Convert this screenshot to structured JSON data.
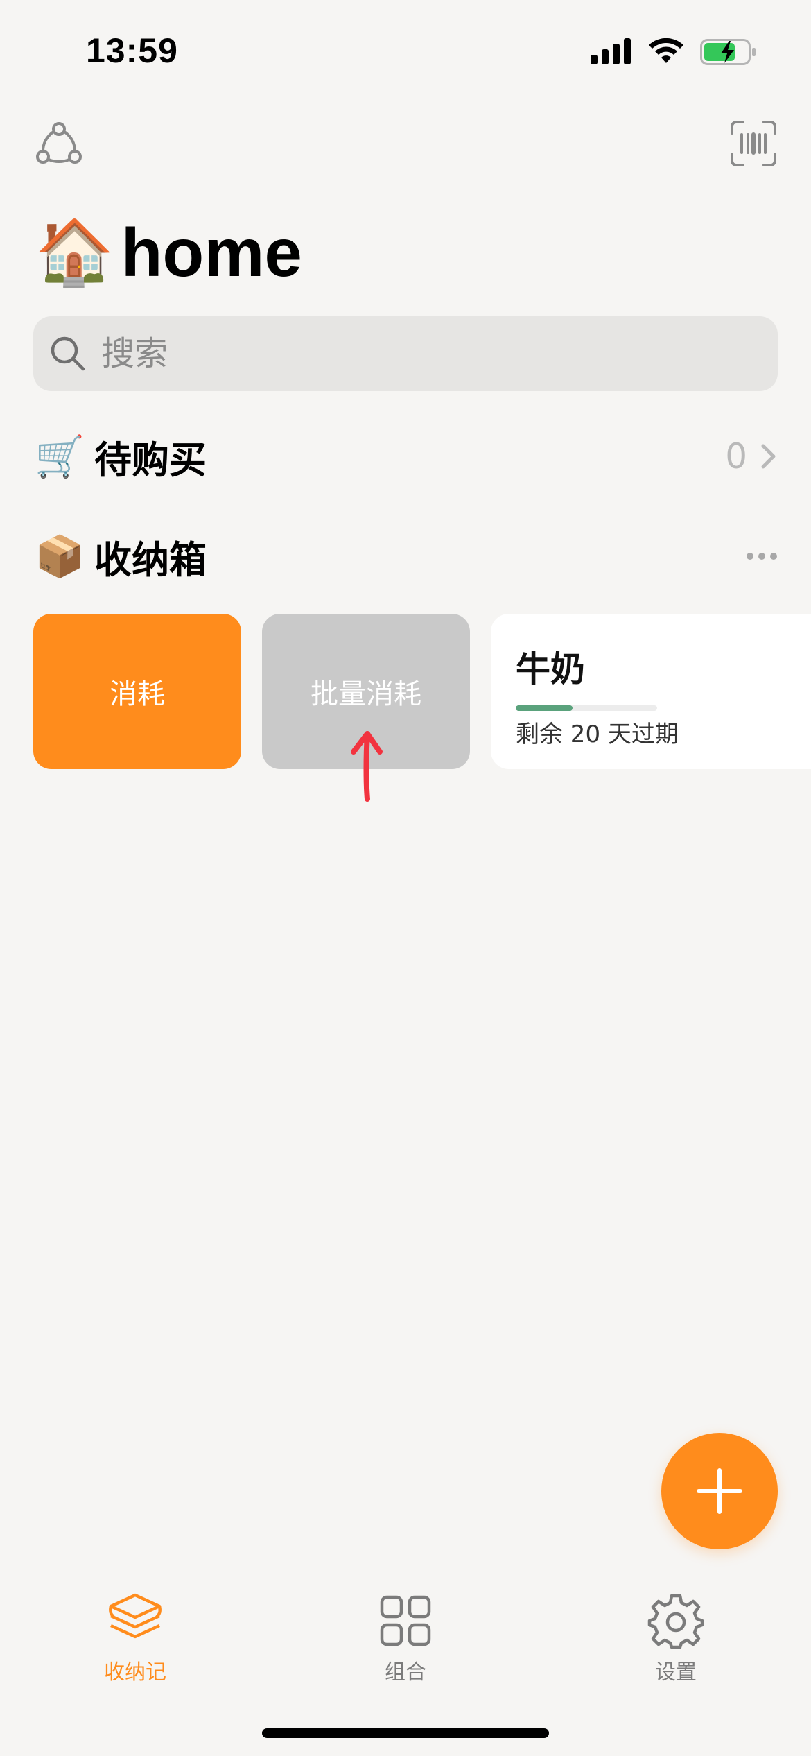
{
  "status_bar": {
    "time": "13:59"
  },
  "header": {
    "title_emoji": "🏠",
    "title": "home"
  },
  "search": {
    "placeholder": "搜索"
  },
  "shopping": {
    "emoji": "🛒",
    "title": "待购买",
    "count": "0"
  },
  "storage": {
    "emoji": "📦",
    "title": "收纳箱"
  },
  "actions": {
    "consume_label": "消耗",
    "batch_consume_label": "批量消耗"
  },
  "item": {
    "name": "牛奶",
    "expiry_text": "剩余 20 天过期",
    "progress_fraction": 0.4
  },
  "tabs": [
    {
      "label": "收纳记",
      "active": true
    },
    {
      "label": "组合",
      "active": false
    },
    {
      "label": "设置",
      "active": false
    }
  ],
  "colors": {
    "accent": "#ff8c1c",
    "inactive": "#7b7b7b",
    "progress": "#5aa27c"
  }
}
